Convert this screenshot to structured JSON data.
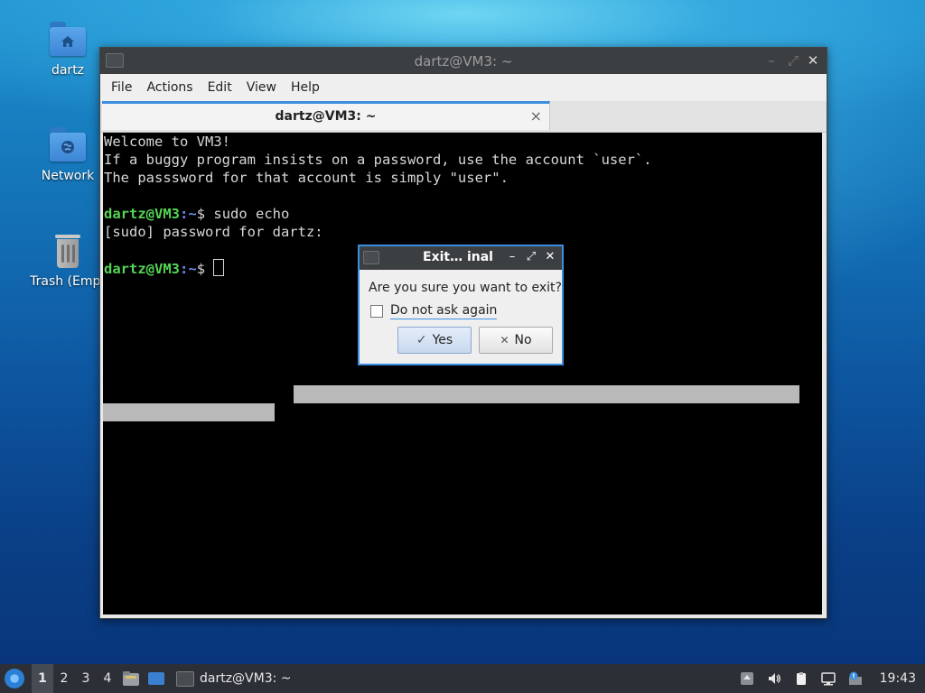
{
  "desktop": {
    "icons": [
      {
        "label": "dartz",
        "icon": "home-folder-icon"
      },
      {
        "label": "Network",
        "icon": "network-folder-icon"
      },
      {
        "label": "Trash (Empt",
        "icon": "trash-icon"
      }
    ]
  },
  "window": {
    "title": "dartz@VM3: ~",
    "buttons": {
      "minimize": "–",
      "maximize": "⤢",
      "close": "✕"
    },
    "menu": [
      "File",
      "Actions",
      "Edit",
      "View",
      "Help"
    ],
    "tab": {
      "label": "dartz@VM3: ~",
      "close": "×"
    }
  },
  "terminal": {
    "lines": [
      "Welcome to VM3!",
      "If a buggy program insists on a password, use the account `user`.",
      "The passsword for that account is simply \"user\"."
    ],
    "prompt_user": "dartz@VM3",
    "prompt_sep": ":",
    "prompt_path": "~",
    "prompt_dollar": "$ ",
    "command": "sudo echo",
    "sudo_prompt": "[sudo] password for dartz:"
  },
  "dialog": {
    "title": "Exit… inal",
    "buttons": {
      "minimize": "–",
      "maximize": "⤢",
      "close": "✕"
    },
    "question": "Are you sure you want to exit?",
    "checkbox_label": "Do not ask again",
    "checkbox_checked": false,
    "yes_label": "Yes",
    "yes_icon": "✓",
    "no_label": "No",
    "no_icon": "✕"
  },
  "taskbar": {
    "workspaces": [
      "1",
      "2",
      "3",
      "4"
    ],
    "active_workspace": "1",
    "task_label": "dartz@VM3: ~",
    "clock": "19:43"
  },
  "colors": {
    "accent": "#3b8ee0",
    "prompt_user": "#54d454",
    "prompt_path": "#6b8cf0"
  }
}
